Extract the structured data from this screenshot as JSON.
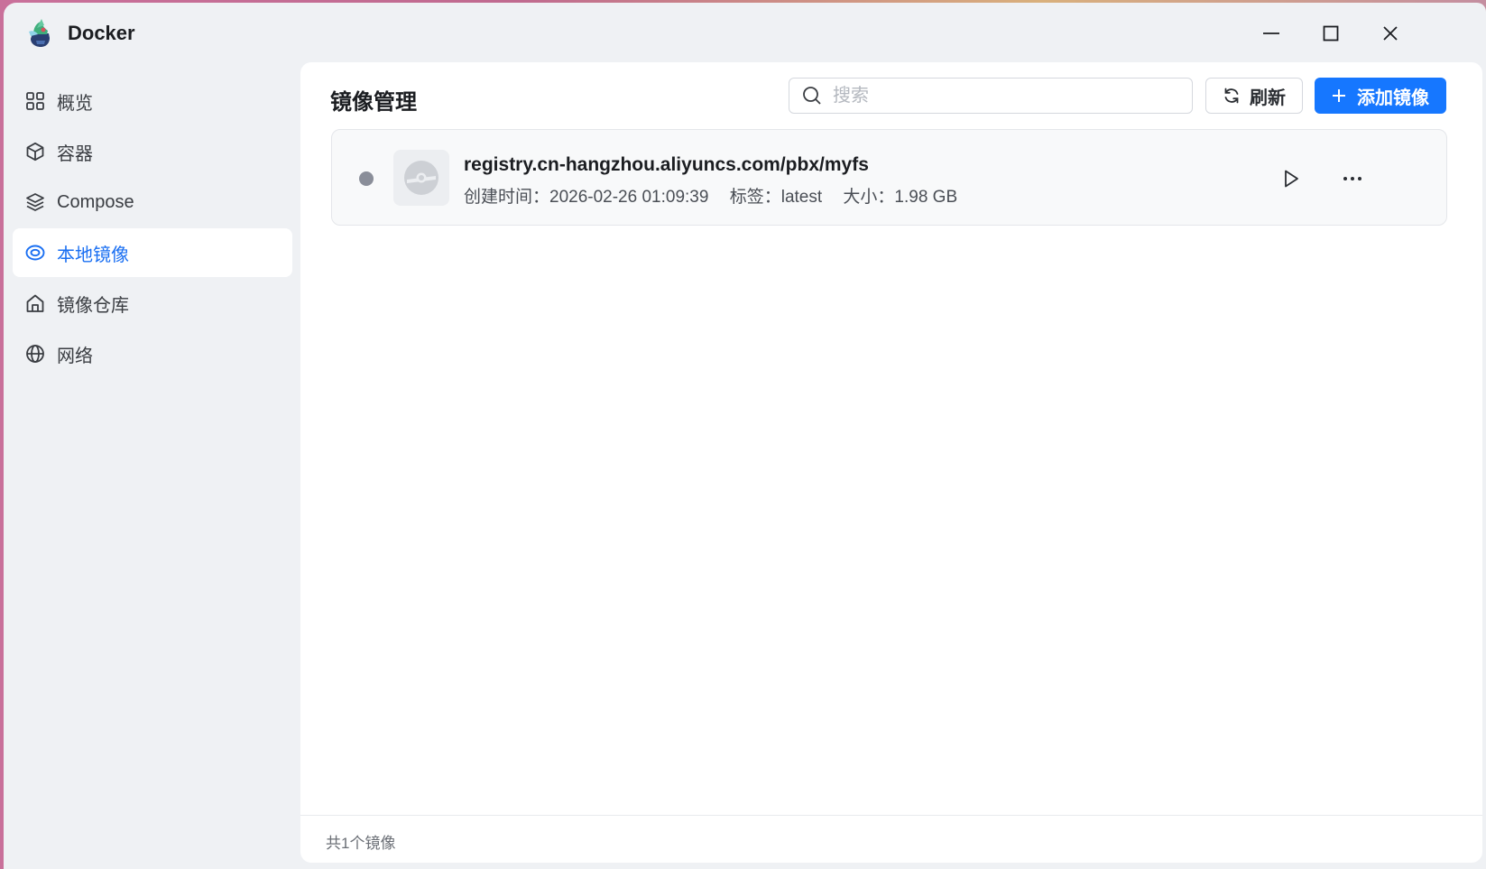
{
  "window": {
    "title": "Docker",
    "controls": [
      "minimize-icon",
      "maximize-icon",
      "close-icon"
    ]
  },
  "sidebar": {
    "items": [
      {
        "label": "概览",
        "icon": "grid-icon",
        "active": false
      },
      {
        "label": "容器",
        "icon": "cube-icon",
        "active": false
      },
      {
        "label": "Compose",
        "icon": "layers-icon",
        "active": false
      },
      {
        "label": "本地镜像",
        "icon": "disc-icon",
        "active": true
      },
      {
        "label": "镜像仓库",
        "icon": "home-icon",
        "active": false
      },
      {
        "label": "网络",
        "icon": "globe-icon",
        "active": false
      }
    ]
  },
  "main": {
    "title": "镜像管理",
    "search": {
      "placeholder": "搜索",
      "value": ""
    },
    "refresh_label": "刷新",
    "add_label": "添加镜像",
    "images": [
      {
        "name": "registry.cn-hangzhou.aliyuncs.com/pbx/myfs",
        "created": "创建时间：2026-02-26 01:09:39",
        "tag": "标签：latest",
        "size": "大小：1.98 GB",
        "status_color": "#8a8e99"
      }
    ],
    "footer_text": "共1个镜像"
  },
  "colors": {
    "accent": "#1677ff",
    "active_text": "#1a6ff2"
  }
}
